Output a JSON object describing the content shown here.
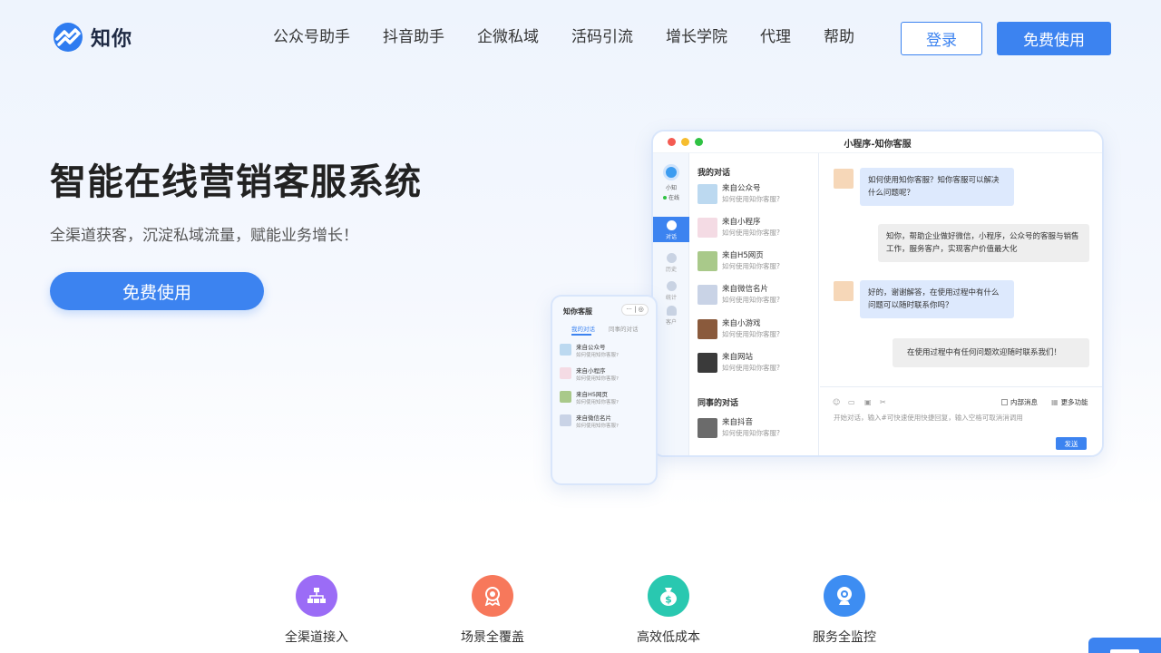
{
  "nav": {
    "logo_text": "知你",
    "items": [
      "公众号助手",
      "抖音助手",
      "企微私域",
      "活码引流",
      "增长学院",
      "代理",
      "帮助"
    ],
    "login": "登录",
    "free": "免费使用"
  },
  "hero": {
    "title": "智能在线营销客服系统",
    "subtitle": "全渠道获客，沉淀私域流量，赋能业务增长！",
    "cta": "免费使用"
  },
  "desktop": {
    "title": "小程序-知你客服",
    "sidebar": {
      "name": "小知",
      "status": "在线",
      "items": [
        "对话",
        "历史",
        "统计",
        "客户"
      ]
    },
    "my_conversations": "我的对话",
    "conversations": [
      {
        "title": "来自公众号",
        "sub": "如何使用知你客服?"
      },
      {
        "title": "来自小程序",
        "sub": "如何使用知你客服?"
      },
      {
        "title": "来自H5网页",
        "sub": "如何使用知你客服?"
      },
      {
        "title": "来自微信名片",
        "sub": "如何使用知你客服?"
      },
      {
        "title": "来自小游戏",
        "sub": "如何使用知你客服?"
      },
      {
        "title": "来自网站",
        "sub": "如何使用知你客服?"
      }
    ],
    "colleague_conversations": "同事的对话",
    "colleague": [
      {
        "title": "来自抖音",
        "sub": "如何使用知你客服?"
      }
    ],
    "messages": [
      {
        "side": "left",
        "text": "如何使用知你客服？知你客服可以解决什么问题呢？"
      },
      {
        "side": "right",
        "text": "知你，帮助企业做好微信，小程序，公众号的客服与销售工作，服务客户，实现客户价值最大化"
      },
      {
        "side": "left",
        "text": "好的，谢谢解答，在使用过程中有什么问题可以随时联系你吗？"
      },
      {
        "side": "right",
        "text": "在使用过程中有任何问题欢迎随时联系我们！"
      }
    ],
    "footer": {
      "internal": "内部消息",
      "more": "更多功能",
      "placeholder": "开始对话，输入#可快速使用快捷回复，输入空格可取消消调用",
      "send": "发送"
    }
  },
  "mobile": {
    "title": "知你客服",
    "tabs": [
      "我的对话",
      "同事的对话"
    ],
    "items": [
      {
        "title": "来自公众号",
        "sub": "如何使用知你客服?"
      },
      {
        "title": "来自小程序",
        "sub": "如何使用知你客服?"
      },
      {
        "title": "来自H5网页",
        "sub": "如何使用知你客服?"
      },
      {
        "title": "来自微信名片",
        "sub": "如何使用知你客服?"
      }
    ]
  },
  "features": [
    {
      "label": "全渠道接入",
      "color": "#9b6cf6",
      "icon": "hierarchy-icon"
    },
    {
      "label": "场景全覆盖",
      "color": "#f7785b",
      "icon": "badge-icon"
    },
    {
      "label": "高效低成本",
      "color": "#29c8b0",
      "icon": "money-bag-icon"
    },
    {
      "label": "服务全监控",
      "color": "#3d8df2",
      "icon": "webcam-icon"
    }
  ],
  "colors": {
    "accent": "#3c83f0"
  }
}
